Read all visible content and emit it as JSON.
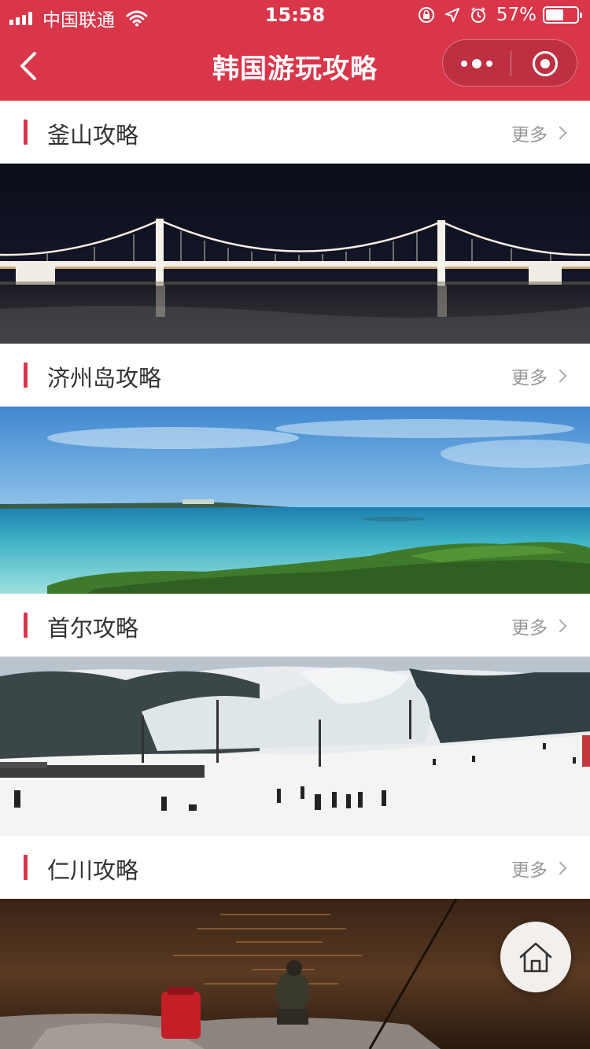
{
  "status_bar": {
    "carrier": "中国联通",
    "time": "15:58",
    "battery_percent_label": "57%",
    "battery_level": 0.57
  },
  "nav": {
    "title": "韩国游玩攻略"
  },
  "sections": [
    {
      "title": "釜山攻略",
      "more": "更多"
    },
    {
      "title": "济州岛攻略",
      "more": "更多"
    },
    {
      "title": "首尔攻略",
      "more": "更多"
    },
    {
      "title": "仁川攻略",
      "more": "更多"
    }
  ],
  "colors": {
    "brand": "#d9364a",
    "text": "#333333",
    "muted": "#999999"
  },
  "icons": {
    "back": "chevron-left-icon",
    "menu": "more-dots-icon",
    "close": "target-circle-icon",
    "home": "home-icon"
  }
}
